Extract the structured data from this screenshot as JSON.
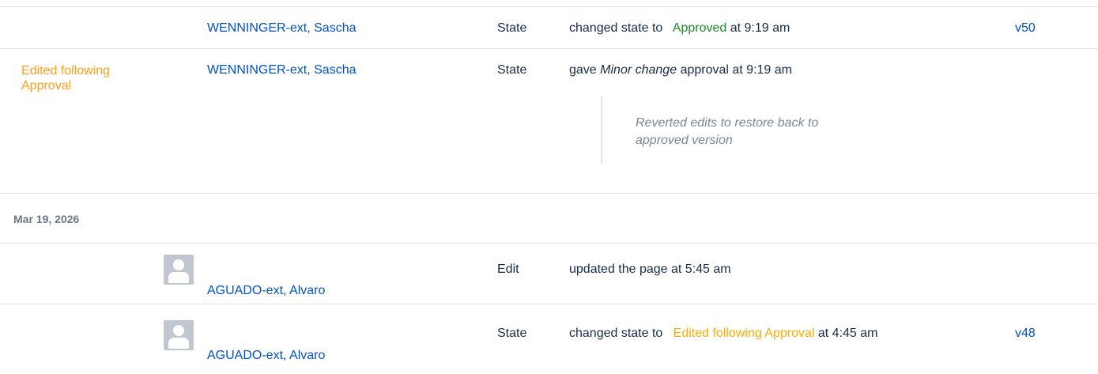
{
  "rows": [
    {
      "author": "WENNINGER-ext, Sascha",
      "type": "State",
      "desc_prefix": "changed state to",
      "state_label": "Approved",
      "desc_suffix": "at 9:19 am",
      "version": "v50"
    },
    {
      "status_label": "Edited following Approval",
      "author": "WENNINGER-ext, Sascha",
      "type": "State",
      "desc_prefix": "gave",
      "desc_em": "Minor change",
      "desc_suffix": "approval at 9:19 am",
      "comment": "Reverted edits to restore back to approved version"
    }
  ],
  "date_header": "Mar 19, 2026",
  "rows2": [
    {
      "author": "AGUADO-ext, Alvaro",
      "type": "Edit",
      "desc": "updated the page at 5:45 am"
    },
    {
      "author": "AGUADO-ext, Alvaro",
      "type": "State",
      "desc_prefix": "changed state to",
      "state_label": "Edited following Approval",
      "desc_suffix": "at 4:45 am",
      "version": "v48"
    }
  ],
  "colors": {
    "link": "#0052cc",
    "approved": "#1e8a2a",
    "edited": "#ffab00",
    "divider": "#dfe1e6"
  },
  "icons": {
    "avatar": "default-user-avatar-icon"
  }
}
